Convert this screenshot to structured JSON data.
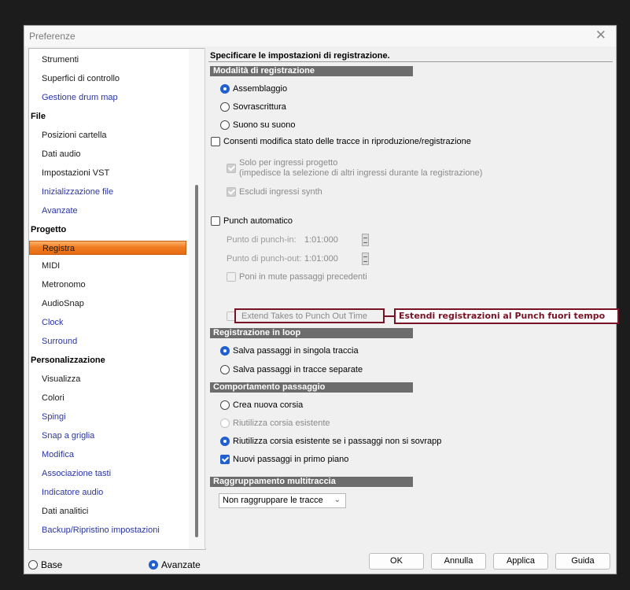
{
  "window": {
    "title": "Preferenze",
    "close_glyph": "✕"
  },
  "sidebar": {
    "items_top": [
      {
        "label": "Strumenti",
        "link": false
      },
      {
        "label": "Superfici di controllo",
        "link": false
      },
      {
        "label": "Gestione drum map",
        "link": true
      }
    ],
    "file": {
      "label": "File",
      "items": [
        {
          "label": "Posizioni cartella",
          "link": false
        },
        {
          "label": "Dati audio",
          "link": false
        },
        {
          "label": "Impostazioni VST",
          "link": false
        },
        {
          "label": "Inizializzazione file",
          "link": true
        },
        {
          "label": "Avanzate",
          "link": true
        }
      ]
    },
    "progetto": {
      "label": "Progetto",
      "items": [
        {
          "label": "Registra",
          "link": false,
          "selected": true
        },
        {
          "label": "MIDI",
          "link": false
        },
        {
          "label": "Metronomo",
          "link": false
        },
        {
          "label": "AudioSnap",
          "link": false
        },
        {
          "label": "Clock",
          "link": true
        },
        {
          "label": "Surround",
          "link": true
        }
      ]
    },
    "personalizzazione": {
      "label": "Personalizzazione",
      "items": [
        {
          "label": "Visualizza",
          "link": false
        },
        {
          "label": "Colori",
          "link": false
        },
        {
          "label": "Spingi",
          "link": true
        },
        {
          "label": "Snap a griglia",
          "link": true
        },
        {
          "label": "Modifica",
          "link": true
        },
        {
          "label": "Associazione tasti",
          "link": true
        },
        {
          "label": "Indicatore audio",
          "link": true
        },
        {
          "label": "Dati analitici",
          "link": false
        },
        {
          "label": "Backup/Ripristino impostazioni",
          "link": true
        }
      ]
    }
  },
  "content": {
    "heading": "Specificare le impostazioni di registrazione.",
    "recording_mode": {
      "header": "Modalità di registrazione",
      "options": [
        "Assemblaggio",
        "Sovrascrittura",
        "Suono su suono"
      ],
      "selected": "Assemblaggio",
      "allow_track_state": "Consenti modifica stato delle tracce in riproduzione/registrazione",
      "project_inputs_line1": "Solo per ingressi progetto",
      "project_inputs_line2": "(impedisce la selezione di altri ingressi durante la registrazione)",
      "exclude_synth": "Escludi ingressi synth"
    },
    "punch": {
      "auto_punch": "Punch automatico",
      "punch_in_label": "Punto di punch-in:",
      "punch_in_value": "1:01:000",
      "punch_out_label": "Punto di punch-out:",
      "punch_out_value": "1:01:000",
      "mute_previous": "Poni in mute passaggi precedenti",
      "extend_takes": "Extend Takes to Punch Out Time",
      "callout": "Estendi registrazioni al Punch fuori tempo"
    },
    "loop": {
      "header": "Registrazione in loop",
      "options": [
        "Salva passaggi in singola traccia",
        "Salva passaggi in tracce separate"
      ],
      "selected": "Salva passaggi in singola traccia"
    },
    "take": {
      "header": "Comportamento passaggio",
      "options": [
        "Crea nuova corsia",
        "Riutilizza corsia esistente",
        "Riutilizza corsia esistente se i passaggi non si sovrapp"
      ],
      "selected": "Riutilizza corsia esistente se i passaggi non si sovrapp",
      "bring_to_front": "Nuovi passaggi in primo piano"
    },
    "multitrack": {
      "header": "Raggruppamento multitraccia",
      "select_value": "Non raggruppare le tracce"
    }
  },
  "footer": {
    "mode_basic": "Base",
    "mode_advanced": "Avanzate",
    "mode_selected": "Avanzate",
    "buttons": {
      "ok": "OK",
      "cancel": "Annulla",
      "apply": "Applica",
      "help": "Guida"
    }
  },
  "colors": {
    "accent": "#1f5fd0",
    "selection": "#f07d22",
    "callout": "#7a1226",
    "link": "#2a35a8"
  }
}
